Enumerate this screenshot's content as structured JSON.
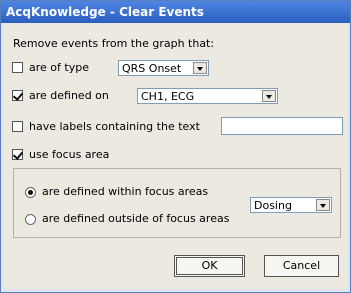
{
  "window": {
    "title": "AcqKnowledge - Clear Events"
  },
  "intro": "Remove events from the graph that:",
  "options": {
    "type": {
      "label": "are of type",
      "checked": false,
      "value": "QRS Onset"
    },
    "defined_on": {
      "label": "are defined on",
      "checked": true,
      "value": "CH1, ECG"
    },
    "labels": {
      "label": "have labels containing the text",
      "checked": false,
      "value": ""
    },
    "focus": {
      "label": "use focus area",
      "checked": true
    }
  },
  "focus_group": {
    "within": {
      "label": "are defined within focus areas",
      "selected": true
    },
    "outside": {
      "label": "are defined outside of focus areas",
      "selected": false
    },
    "area_value": "Dosing"
  },
  "buttons": {
    "ok": "OK",
    "cancel": "Cancel"
  }
}
